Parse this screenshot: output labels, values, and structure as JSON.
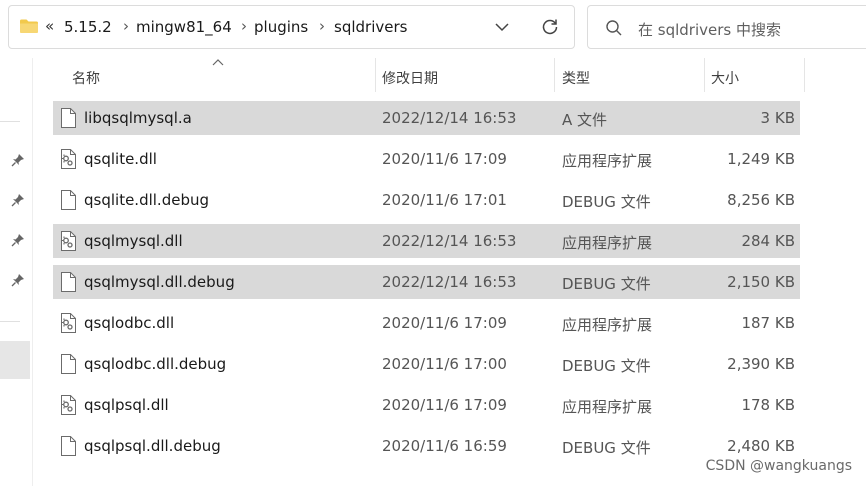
{
  "address_bar": {
    "overflow": "«",
    "crumbs": [
      "5.15.2",
      "mingw81_64",
      "plugins",
      "sqldrivers"
    ]
  },
  "search": {
    "placeholder": "在 sqldrivers 中搜索"
  },
  "columns": {
    "name": "名称",
    "date": "修改日期",
    "type": "类型",
    "size": "大小"
  },
  "files": [
    {
      "name": "libqsqlmysql.a",
      "date": "2022/12/14 16:53",
      "type": "A 文件",
      "size": "3 KB",
      "icon": "file-icon",
      "selected": true
    },
    {
      "name": "qsqlite.dll",
      "date": "2020/11/6 17:09",
      "type": "应用程序扩展",
      "size": "1,249 KB",
      "icon": "dll-file-icon",
      "selected": false
    },
    {
      "name": "qsqlite.dll.debug",
      "date": "2020/11/6 17:01",
      "type": "DEBUG 文件",
      "size": "8,256 KB",
      "icon": "file-icon",
      "selected": false
    },
    {
      "name": "qsqlmysql.dll",
      "date": "2022/12/14 16:53",
      "type": "应用程序扩展",
      "size": "284 KB",
      "icon": "dll-file-icon",
      "selected": true
    },
    {
      "name": "qsqlmysql.dll.debug",
      "date": "2022/12/14 16:53",
      "type": "DEBUG 文件",
      "size": "2,150 KB",
      "icon": "file-icon",
      "selected": true
    },
    {
      "name": "qsqlodbc.dll",
      "date": "2020/11/6 17:09",
      "type": "应用程序扩展",
      "size": "187 KB",
      "icon": "dll-file-icon",
      "selected": false
    },
    {
      "name": "qsqlodbc.dll.debug",
      "date": "2020/11/6 17:00",
      "type": "DEBUG 文件",
      "size": "2,390 KB",
      "icon": "file-icon",
      "selected": false
    },
    {
      "name": "qsqlpsql.dll",
      "date": "2020/11/6 17:09",
      "type": "应用程序扩展",
      "size": "178 KB",
      "icon": "dll-file-icon",
      "selected": false
    },
    {
      "name": "qsqlpsql.dll.debug",
      "date": "2020/11/6 16:59",
      "type": "DEBUG 文件",
      "size": "2,480 KB",
      "icon": "file-icon",
      "selected": false
    }
  ],
  "watermark": "CSDN @wangkuangs",
  "colors": {
    "selection": "#d9d9d9",
    "folder": "#f2c94c"
  }
}
